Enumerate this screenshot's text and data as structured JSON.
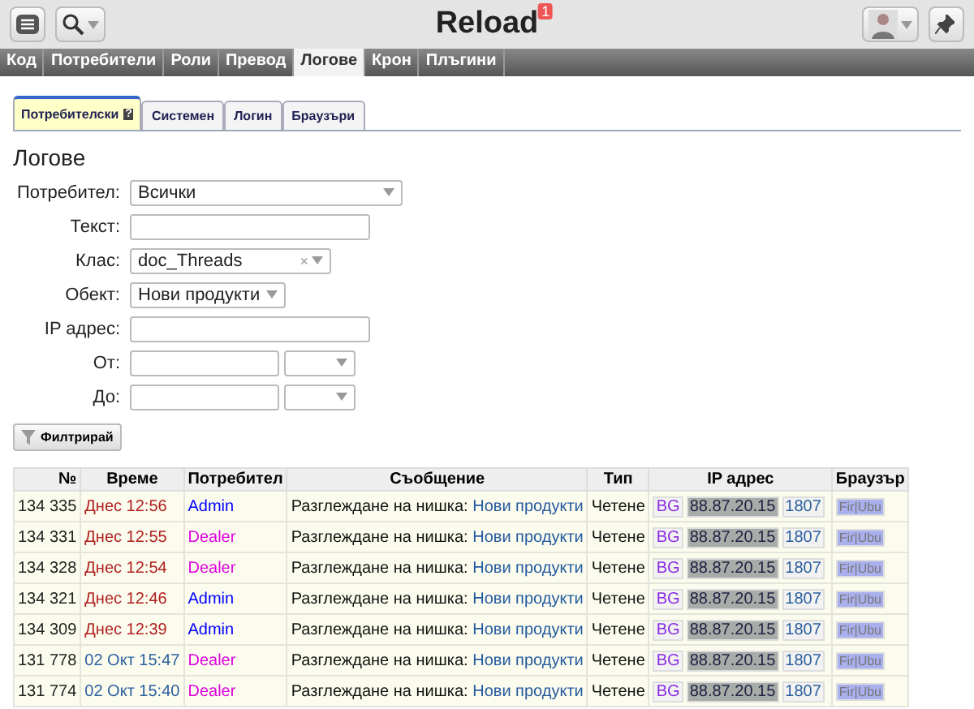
{
  "header": {
    "title": "Reload",
    "notification_count": "1"
  },
  "nav": [
    {
      "label": "Код",
      "selected": false
    },
    {
      "label": "Потребители",
      "selected": false
    },
    {
      "label": "Роли",
      "selected": false
    },
    {
      "label": "Превод",
      "selected": false
    },
    {
      "label": "Логове",
      "selected": true
    },
    {
      "label": "Крон",
      "selected": false
    },
    {
      "label": "Плъгини",
      "selected": false
    }
  ],
  "tabs": [
    {
      "label": "Потребителски",
      "selected": true,
      "help": "?"
    },
    {
      "label": "Системен",
      "selected": false
    },
    {
      "label": "Логин",
      "selected": false
    },
    {
      "label": "Браузъри",
      "selected": false
    }
  ],
  "page_title": "Логове",
  "form": [
    {
      "label": "Потребител:",
      "kind": "select",
      "value": "Всички"
    },
    {
      "label": "Текст:",
      "kind": "text"
    },
    {
      "label": "Клас:",
      "kind": "select",
      "value": "doc_Threads",
      "clear_icon": "×"
    },
    {
      "label": "Обект:",
      "kind": "select",
      "value": "Нови продукти"
    },
    {
      "label": "IP адрес:",
      "kind": "text"
    },
    {
      "label": "От:",
      "kind": "date"
    },
    {
      "label": "До:",
      "kind": "date"
    }
  ],
  "filter_button": "Филтрирай",
  "table": {
    "columns": [
      "№",
      "Време",
      "Потребител",
      "Съобщение",
      "Тип",
      "IP адрес",
      "Браузър"
    ],
    "rows": [
      {
        "no": "134 335",
        "time": {
          "text": "Днес 12:56",
          "kind": "today"
        },
        "user": {
          "name": "Admin",
          "color": "#0000ff"
        },
        "message": {
          "text": "Разглеждане на нишка:",
          "link": "Нови продукти"
        },
        "type": "Четене",
        "country": "BG",
        "ip": "88.87.20.15",
        "port": "1807",
        "browser": "Fir|Ubu"
      },
      {
        "no": "134 331",
        "time": {
          "text": "Днес 12:55",
          "kind": "today"
        },
        "user": {
          "name": "Dealer",
          "color": "#dd00dd"
        },
        "message": {
          "text": "Разглеждане на нишка:",
          "link": "Нови продукти"
        },
        "type": "Четене",
        "country": "BG",
        "ip": "88.87.20.15",
        "port": "1807",
        "browser": "Fir|Ubu"
      },
      {
        "no": "134 328",
        "time": {
          "text": "Днес 12:54",
          "kind": "today"
        },
        "user": {
          "name": "Dealer",
          "color": "#dd00dd"
        },
        "message": {
          "text": "Разглеждане на нишка:",
          "link": "Нови продукти"
        },
        "type": "Четене",
        "country": "BG",
        "ip": "88.87.20.15",
        "port": "1807",
        "browser": "Fir|Ubu"
      },
      {
        "no": "134 321",
        "time": {
          "text": "Днес 12:46",
          "kind": "today"
        },
        "user": {
          "name": "Admin",
          "color": "#0000ff"
        },
        "message": {
          "text": "Разглеждане на нишка:",
          "link": "Нови продукти"
        },
        "type": "Четене",
        "country": "BG",
        "ip": "88.87.20.15",
        "port": "1807",
        "browser": "Fir|Ubu"
      },
      {
        "no": "134 309",
        "time": {
          "text": "Днес 12:39",
          "kind": "today"
        },
        "user": {
          "name": "Admin",
          "color": "#0000ff"
        },
        "message": {
          "text": "Разглеждане на нишка:",
          "link": "Нови продукти"
        },
        "type": "Четене",
        "country": "BG",
        "ip": "88.87.20.15",
        "port": "1807",
        "browser": "Fir|Ubu"
      },
      {
        "no": "131 778",
        "time": {
          "text": "02 Окт 15:47",
          "kind": "date"
        },
        "user": {
          "name": "Dealer",
          "color": "#dd00dd"
        },
        "message": {
          "text": "Разглеждане на нишка:",
          "link": "Нови продукти"
        },
        "type": "Четене",
        "country": "BG",
        "ip": "88.87.20.15",
        "port": "1807",
        "browser": "Fir|Ubu"
      },
      {
        "no": "131 774",
        "time": {
          "text": "02 Окт 15:40",
          "kind": "date"
        },
        "user": {
          "name": "Dealer",
          "color": "#dd00dd"
        },
        "message": {
          "text": "Разглеждане на нишка:",
          "link": "Нови продукти"
        },
        "type": "Четене",
        "country": "BG",
        "ip": "88.87.20.15",
        "port": "1807",
        "browser": "Fir|Ubu"
      }
    ]
  }
}
